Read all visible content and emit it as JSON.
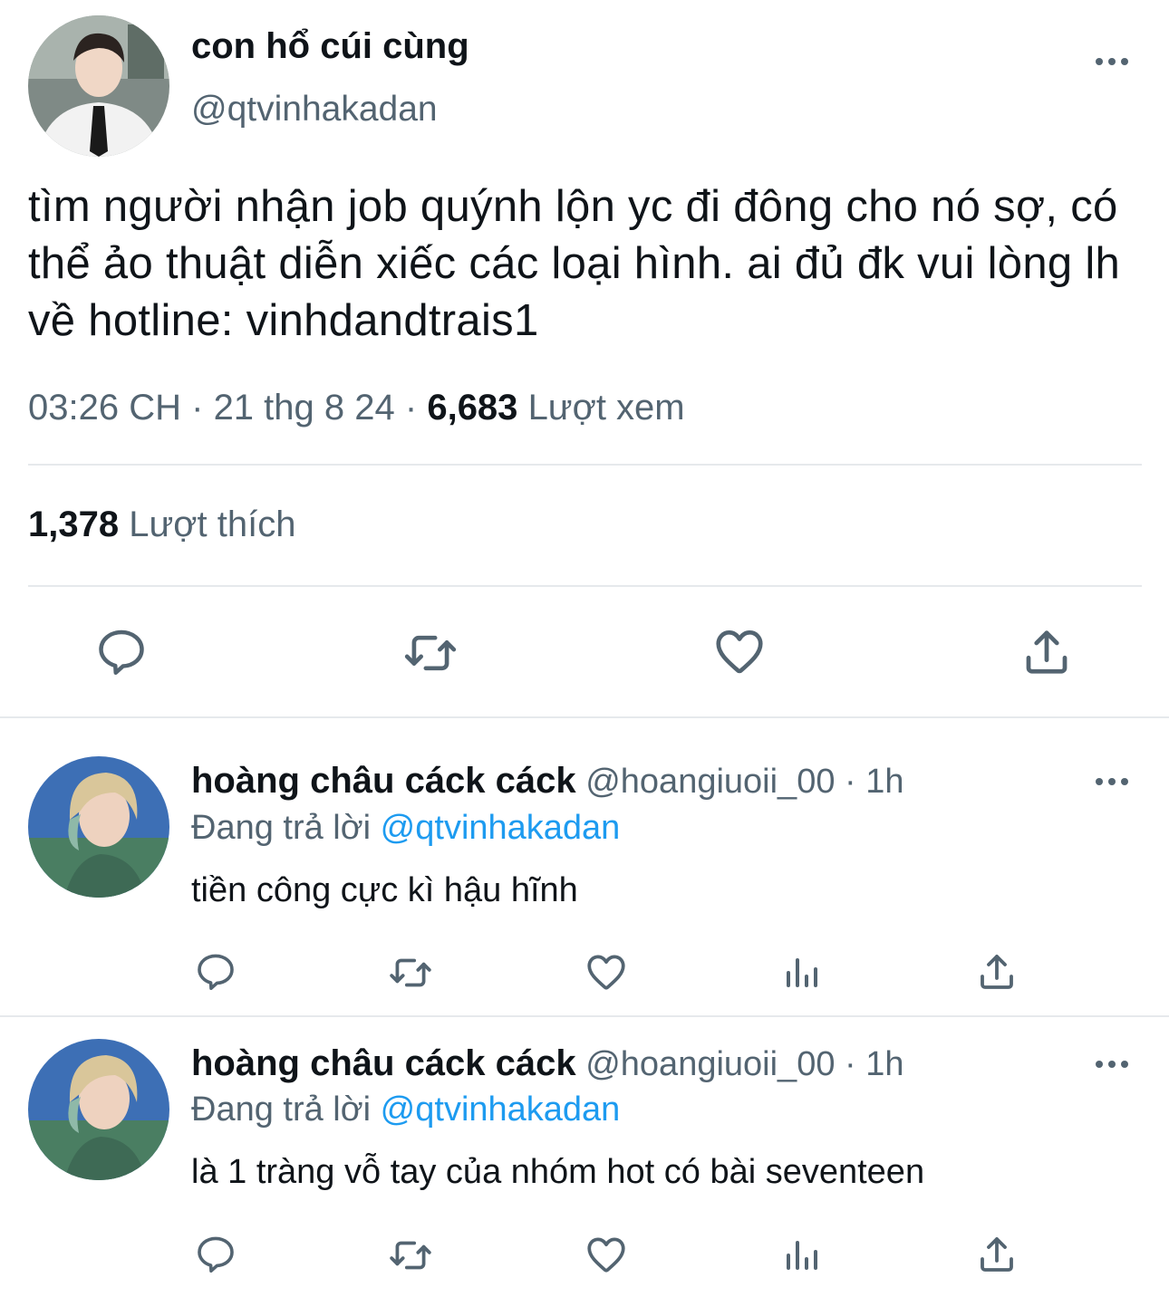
{
  "main_tweet": {
    "author_name": "con hổ cúi cùng",
    "author_handle": "@qtvinhakadan",
    "text": "tìm người nhận job quýnh lộn yc đi đông cho nó sợ, có thể ảo thuật diễn xiếc các loại hình. ai đủ đk vui lòng lh về hotline: vinhdandtrais1",
    "time": "03:26 CH",
    "separator": "·",
    "date": "21 thg 8 24",
    "views_count": "6,683",
    "views_label": "Lượt xem",
    "likes_count": "1,378",
    "likes_label": "Lượt thích"
  },
  "replies": [
    {
      "author_name": "hoàng châu cáck cáck",
      "author_handle": "@hoangiuoii_00",
      "dot": "·",
      "age": "1h",
      "replying_prefix": "Đang trả lời",
      "replying_to": "@qtvinhakadan",
      "text": "tiền công cực kì hậu hĩnh"
    },
    {
      "author_name": "hoàng châu cáck cáck",
      "author_handle": "@hoangiuoii_00",
      "dot": "·",
      "age": "1h",
      "replying_prefix": "Đang trả lời",
      "replying_to": "@qtvinhakadan",
      "text": "là 1 tràng vỗ tay của nhóm hot có bài seventeen"
    }
  ],
  "icons": {
    "reply": "speech-bubble-icon",
    "retweet": "retweet-arrows-icon",
    "like": "heart-icon",
    "views": "bar-chart-icon",
    "share": "share-upload-icon",
    "more": "more-dots-icon"
  },
  "colors": {
    "text": "#0f1419",
    "muted": "#536471",
    "link": "#1d9bf0",
    "divider": "#e6e9ec"
  }
}
